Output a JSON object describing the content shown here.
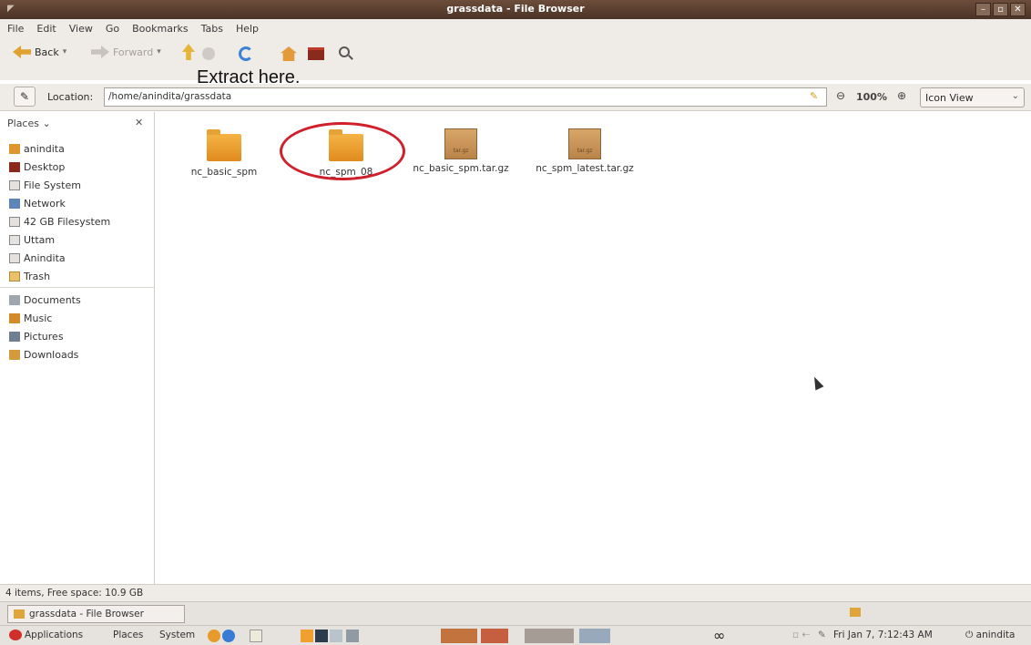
{
  "window": {
    "title": "grassdata - File Browser"
  },
  "menu": [
    "File",
    "Edit",
    "View",
    "Go",
    "Bookmarks",
    "Tabs",
    "Help"
  ],
  "toolbar": {
    "back_label": "Back",
    "forward_label": "Forward"
  },
  "overlay_annotation": "Extract here.",
  "location": {
    "label": "Location:",
    "path": "/home/anindita/grassdata",
    "zoom": "100%",
    "view_mode": "Icon View"
  },
  "sidebar": {
    "header": "Places",
    "items": [
      {
        "label": "anindita",
        "icon": "home-icon"
      },
      {
        "label": "Desktop",
        "icon": "desktop-icon"
      },
      {
        "label": "File System",
        "icon": "drive-icon"
      },
      {
        "label": "Network",
        "icon": "network-icon"
      },
      {
        "label": "42 GB Filesystem",
        "icon": "drive-icon"
      },
      {
        "label": "Uttam",
        "icon": "drive-icon"
      },
      {
        "label": "Anindita",
        "icon": "drive-icon"
      },
      {
        "label": "Trash",
        "icon": "trash-icon"
      }
    ],
    "bookmarks": [
      {
        "label": "Documents",
        "icon": "documents-icon"
      },
      {
        "label": "Music",
        "icon": "music-icon"
      },
      {
        "label": "Pictures",
        "icon": "pictures-icon"
      },
      {
        "label": "Downloads",
        "icon": "downloads-icon"
      }
    ]
  },
  "files": [
    {
      "name": "nc_basic_spm",
      "type": "folder"
    },
    {
      "name": "nc_spm_08",
      "type": "folder",
      "highlighted": true
    },
    {
      "name": "nc_basic_spm.tar.gz",
      "type": "archive",
      "badge": "tar.gz"
    },
    {
      "name": "nc_spm_latest.tar.gz",
      "type": "archive",
      "badge": "tar.gz"
    }
  ],
  "status": "4 items, Free space: 10.9 GB",
  "taskbar": {
    "window_button": "grassdata - File Browser"
  },
  "panel": {
    "menus": [
      "Applications",
      "Places",
      "System"
    ],
    "clock": "Fri Jan 7, 7:12:43 AM",
    "user": "anindita",
    "infinity": "∞"
  },
  "colors": {
    "titlebar": "#5a3e2f",
    "highlight_circle": "#d0202b",
    "folder": "#e8992a"
  }
}
